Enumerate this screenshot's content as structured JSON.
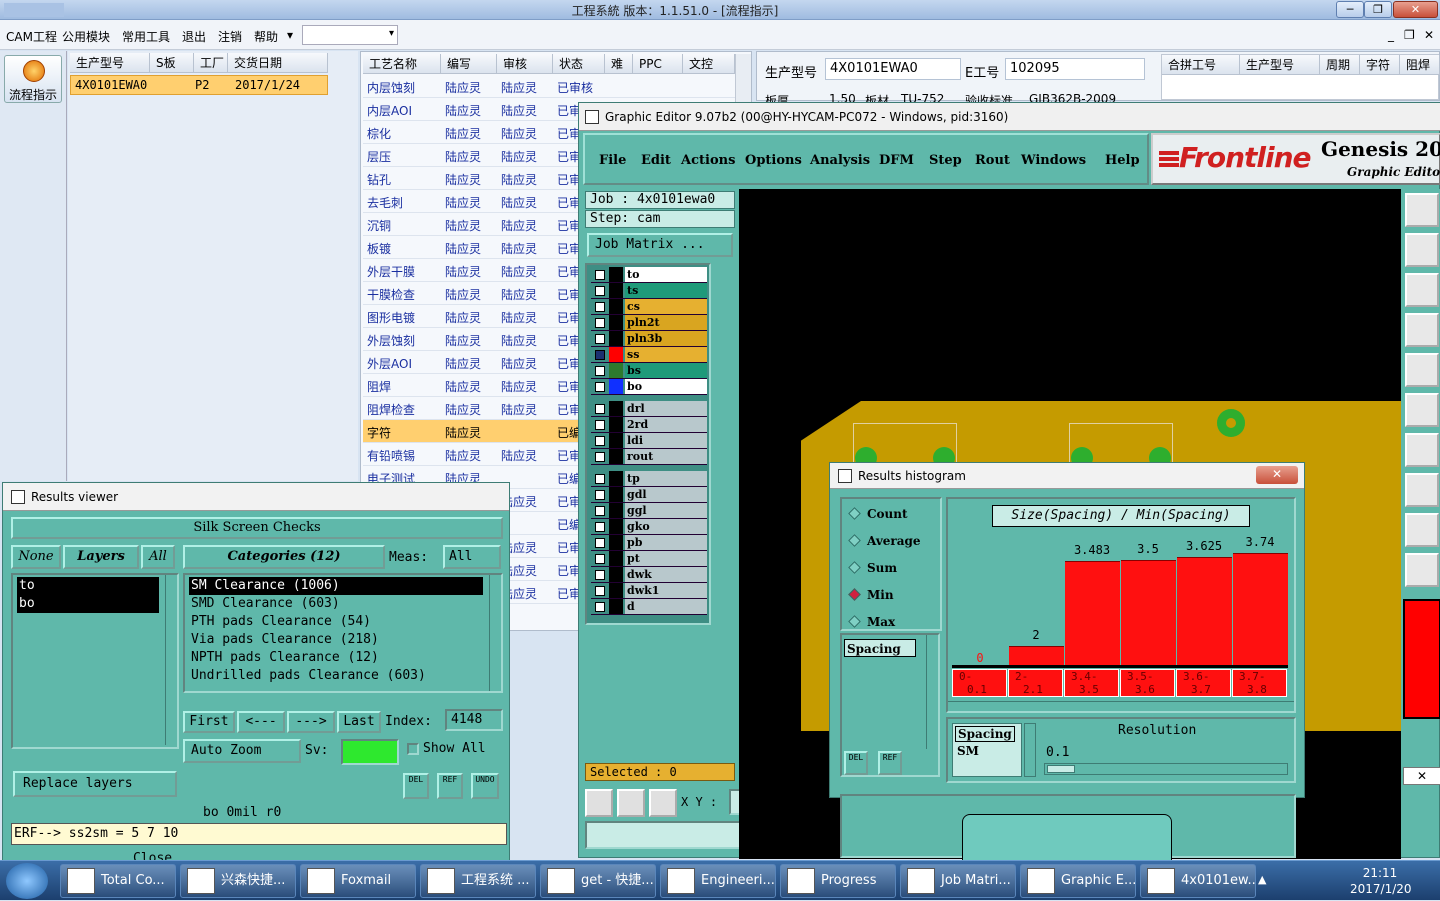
{
  "window": {
    "title": "工程系統   版本：1.1.51.0 - [流程指示]",
    "min": "─",
    "max": "❐",
    "close": "✕"
  },
  "menu": {
    "items": [
      "CAM工程",
      "公用模块",
      "常用工具",
      "退出",
      "注销",
      "帮助"
    ],
    "dropdown_arrow": "▾",
    "mdi_min": "_",
    "mdi_restore": "❐",
    "mdi_close": "✕"
  },
  "left": {
    "flow_button": "流程指示"
  },
  "prodlist": {
    "headers": [
      "生产型号",
      "S板",
      "工厂",
      "交货日期"
    ],
    "row": [
      "4X0101EWA0",
      "P2",
      "2017/1/24"
    ]
  },
  "process": {
    "headers": [
      "工艺名称",
      "编写",
      "审核",
      "状态",
      "难",
      "PPC",
      "文控"
    ],
    "rows": [
      [
        "内层蚀刻",
        "陆应灵",
        "陆应灵",
        "已审核"
      ],
      [
        "内层AOI",
        "陆应灵",
        "陆应灵",
        "已审"
      ],
      [
        "棕化",
        "陆应灵",
        "陆应灵",
        "已审"
      ],
      [
        "层压",
        "陆应灵",
        "陆应灵",
        "已审"
      ],
      [
        "钻孔",
        "陆应灵",
        "陆应灵",
        "已审"
      ],
      [
        "去毛刺",
        "陆应灵",
        "陆应灵",
        "已审"
      ],
      [
        "沉铜",
        "陆应灵",
        "陆应灵",
        "已审"
      ],
      [
        "板镀",
        "陆应灵",
        "陆应灵",
        "已审"
      ],
      [
        "外层干膜",
        "陆应灵",
        "陆应灵",
        "已审"
      ],
      [
        "干膜检查",
        "陆应灵",
        "陆应灵",
        "已审"
      ],
      [
        "图形电镀",
        "陆应灵",
        "陆应灵",
        "已审"
      ],
      [
        "外层蚀刻",
        "陆应灵",
        "陆应灵",
        "已审"
      ],
      [
        "外层AOI",
        "陆应灵",
        "陆应灵",
        "已审"
      ],
      [
        "阻焊",
        "陆应灵",
        "陆应灵",
        "已审"
      ],
      [
        "阻焊检查",
        "陆应灵",
        "陆应灵",
        "已审"
      ],
      [
        "字符",
        "陆应灵",
        "",
        "已编"
      ],
      [
        "有铅喷锡",
        "陆应灵",
        "陆应灵",
        "已审"
      ],
      [
        "电子测试",
        "陆应灵",
        "",
        "已编"
      ],
      [
        "",
        "",
        "陆应灵",
        "已审"
      ],
      [
        "",
        "",
        "",
        "已编"
      ],
      [
        "",
        "",
        "陆应灵",
        "已审"
      ],
      [
        "",
        "",
        "陆应灵",
        "已审"
      ],
      [
        "",
        "",
        "陆应灵",
        "已审"
      ]
    ]
  },
  "rtpanel": {
    "prod_label": "生产型号",
    "prod_value": "4X0101EWA0",
    "eno_label": "E工号",
    "eno_value": "102095",
    "row2": [
      "板厚",
      "1.50",
      "板材",
      "TU-752",
      "验收标准",
      "GJB362B-2009"
    ],
    "headers": [
      "合拼工号",
      "生产型号",
      "周期",
      "字符",
      "阻焊"
    ]
  },
  "ge": {
    "title": "Graphic Editor 9.07b2 (00@HY-HYCAM-PC072 - Windows, pid:3160)",
    "menu": [
      "File",
      "Edit",
      "Actions",
      "Options",
      "Analysis",
      "DFM",
      "Step",
      "Rout",
      "Windows",
      "Help"
    ],
    "logo": "Frontline",
    "product": "Genesis 2000",
    "product_sub": "Graphic Editor",
    "job": "Job  : 4x0101ewa0",
    "step": "Step: cam",
    "job_matrix": "Job Matrix ...",
    "layers_group1": [
      {
        "name": "to",
        "bg": "#ffffff",
        "color": "#000000",
        "checked": false
      },
      {
        "name": "ts",
        "bg": "#1f9a7a",
        "color": "#000000",
        "checked": false
      },
      {
        "name": "cs",
        "bg": "#e6b030",
        "color": "#000000",
        "checked": false
      },
      {
        "name": "pln2t",
        "bg": "#d9a520",
        "color": "#000000",
        "checked": false
      },
      {
        "name": "pln3b",
        "bg": "#d9a520",
        "color": "#000000",
        "checked": false
      },
      {
        "name": "ss",
        "bg": "#e6b030",
        "color": "#ff0000",
        "checked": true
      },
      {
        "name": "bs",
        "bg": "#1f9a7a",
        "color": "#2d7a2d",
        "checked": false
      },
      {
        "name": "bo",
        "bg": "#ffffff",
        "color": "#1030ff",
        "checked": false
      }
    ],
    "layers_group2": [
      "drl",
      "2rd",
      "ldi",
      "rout"
    ],
    "layers_group3": [
      "tp",
      "gdl",
      "ggl",
      "gko",
      "pb",
      "pt",
      "dwk",
      "dwk1",
      "d"
    ],
    "selected": "Selected : 0",
    "xy_label": "X Y :",
    "close_x": "✕",
    "icons": [
      "open-job-icon",
      "matrix-icon",
      "zoom-fit-icon",
      "options-icon",
      "snapshot-icon",
      "net-icon",
      "measure-icon",
      "feature-icon",
      "drc-icon",
      "cursor-icon"
    ]
  },
  "rv": {
    "title": "Results viewer",
    "group": "Silk Screen Checks",
    "btn_none": "None",
    "btn_layers": "Layers",
    "btn_all": "All",
    "categories_label": "Categories (12)",
    "meas_label": "Meas:",
    "meas_value": "All",
    "layers": [
      "to",
      "bo"
    ],
    "categories": [
      "SM Clearance (1006)",
      "SMD Clearance (603)",
      "PTH pads Clearance (54)",
      "Via pads Clearance (218)",
      "NPTH pads Clearance (12)",
      "Undrilled pads Clearance (603)"
    ],
    "nav": [
      "First",
      "<---",
      "--->",
      "Last"
    ],
    "index_label": "Index:",
    "index_value": "4148",
    "auto_zoom": "Auto Zoom",
    "sv_label": "Sv:",
    "show_all": "Show All",
    "replace_layers": "Replace layers",
    "del": "DEL",
    "ref": "REF",
    "undo": "UNDO",
    "status": "bo 0mil  r0",
    "erf": "ERF--> ss2sm = 5 7 10",
    "close_btn": "Close"
  },
  "hist": {
    "title": "Results histogram",
    "modes": [
      "Count",
      "Average",
      "Sum",
      "Min",
      "Max"
    ],
    "selected_mode": "Min",
    "spacing_list": [
      "Spacing"
    ],
    "del": "DEL",
    "ref": "REF",
    "spacing_sm": [
      "Spacing",
      "SM"
    ],
    "resolution_label": "Resolution",
    "resolution_value": "0.1",
    "close_x": "✕"
  },
  "chart_data": {
    "type": "bar",
    "title": "Size(Spacing) / Min(Spacing)",
    "categories": [
      "0-0.1",
      "2-2.1",
      "3.4-3.5",
      "3.5-3.6",
      "3.6-3.7",
      "3.7-3.8"
    ],
    "category_labels": [
      [
        "0-",
        "0.1"
      ],
      [
        "2-",
        "2.1"
      ],
      [
        "3.4-",
        "3.5"
      ],
      [
        "3.5-",
        "3.6"
      ],
      [
        "3.6-",
        "3.7"
      ],
      [
        "3.7-",
        "3.8"
      ]
    ],
    "values": [
      0,
      2,
      3.483,
      3.5,
      3.625,
      3.74
    ],
    "value_labels": [
      "0",
      "2",
      "3.483",
      "3.5",
      "3.625",
      "3.74"
    ],
    "ylim": [
      0,
      3.74
    ],
    "bar_color": "#ff1010"
  },
  "taskbar": {
    "items": [
      "Total Co...",
      "兴森快捷...",
      "Foxmail",
      "工程系统 ...",
      "get - 快捷...",
      "Engineeri...",
      "Progress",
      "Job Matri...",
      "Graphic E...",
      "4x0101ew..."
    ],
    "time": "21:11",
    "date": "2017/1/20"
  }
}
